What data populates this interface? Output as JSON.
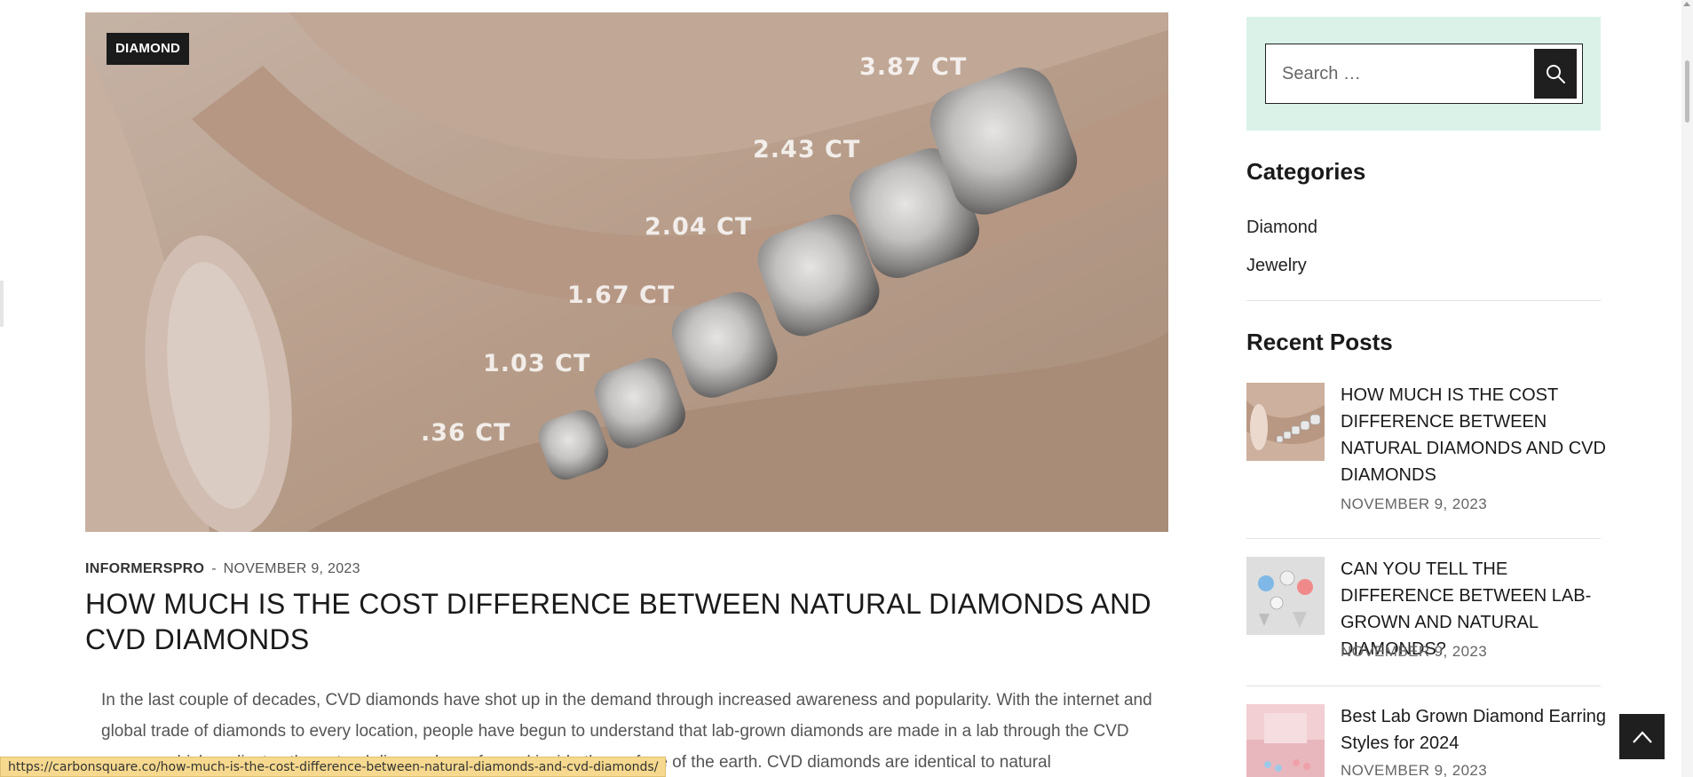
{
  "post": {
    "category_tag": "DIAMOND",
    "carat_labels": [
      "3.87 CT",
      "2.43 CT",
      "2.04 CT",
      "1.67 CT",
      "1.03 CT",
      ".36 CT"
    ],
    "author": "INFORMERSPRO",
    "separator": "-",
    "date": "NOVEMBER 9, 2023",
    "title": "HOW MUCH IS THE COST DIFFERENCE BETWEEN NATURAL DIAMONDS AND CVD DIAMONDS",
    "excerpt": "In the last couple of decades, CVD diamonds have shot up in the demand through increased awareness and popularity. With the internet and global trade of diamonds to every location, people have begun to understand that lab-grown diamonds are made in a lab through the CVD process which replicates the natural diamond was formed inside the surface of the earth. CVD diamonds are identical to natural"
  },
  "sidebar": {
    "search": {
      "placeholder": "Search …",
      "value": "",
      "icon": "search-icon"
    },
    "categories": {
      "title": "Categories",
      "items": [
        "Diamond",
        "Jewelry"
      ]
    },
    "recent_posts": {
      "title": "Recent Posts",
      "items": [
        {
          "title": "HOW MUCH IS THE COST DIFFERENCE BETWEEN NATURAL DIAMONDS AND CVD DIAMONDS",
          "date": "NOVEMBER 9, 2023"
        },
        {
          "title": "CAN YOU TELL THE DIFFERENCE BETWEEN LAB-GROWN AND NATURAL DIAMONDS?",
          "date": "NOVEMBER 9, 2023"
        },
        {
          "title": "Best Lab Grown Diamond Earring Styles for 2024",
          "date": "NOVEMBER 9, 2023"
        }
      ]
    }
  },
  "back_to_top": {
    "icon": "chevron-up-icon"
  },
  "status_bar": {
    "url": "https://carbonsquare.co/how-much-is-the-cost-difference-between-natural-diamonds-and-cvd-diamonds/"
  },
  "colors": {
    "search_bg": "#daf2e8",
    "dark": "#1f1f1f",
    "status_bg": "#f6d98e"
  }
}
